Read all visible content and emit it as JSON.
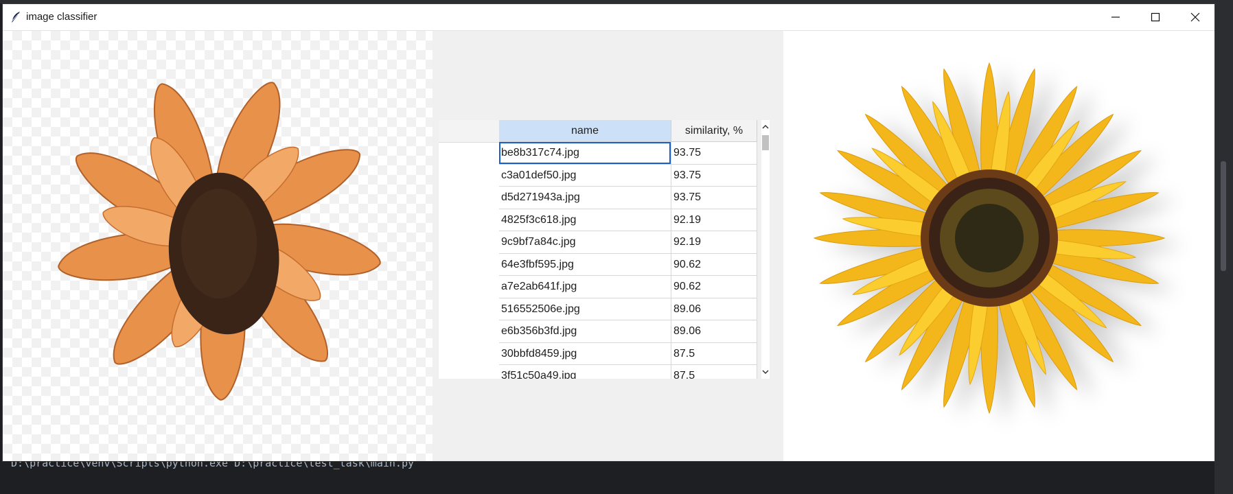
{
  "window": {
    "title": "image classifier"
  },
  "icons": {
    "app": "feather-icon",
    "minimize": "minimize-icon",
    "maximize": "maximize-icon",
    "close": "close-icon",
    "scroll_up": "chevron-up-icon",
    "scroll_down": "chevron-down-icon"
  },
  "images": {
    "query": "dried orange sunflower on transparent background",
    "match": "yellow sunflower on white background"
  },
  "table": {
    "columns": [
      "name",
      "similarity, %"
    ],
    "rows": [
      {
        "name": "be8b317c74.jpg",
        "similarity": "93.75"
      },
      {
        "name": "c3a01def50.jpg",
        "similarity": "93.75"
      },
      {
        "name": "d5d271943a.jpg",
        "similarity": "93.75"
      },
      {
        "name": "4825f3c618.jpg",
        "similarity": "92.19"
      },
      {
        "name": "9c9bf7a84c.jpg",
        "similarity": "92.19"
      },
      {
        "name": "64e3fbf595.jpg",
        "similarity": "90.62"
      },
      {
        "name": "a7e2ab641f.jpg",
        "similarity": "90.62"
      },
      {
        "name": "516552506e.jpg",
        "similarity": "89.06"
      },
      {
        "name": "e6b356b3fd.jpg",
        "similarity": "89.06"
      },
      {
        "name": "30bbfd8459.jpg",
        "similarity": "87.5"
      },
      {
        "name": "3f51c50a49.jpg",
        "similarity": "87.5"
      }
    ],
    "selected_row": 0
  },
  "terminal": {
    "command": "D:\\practice\\venv\\Scripts\\python.exe D:\\practice\\test_task\\main.py"
  },
  "colors": {
    "header_selected": "#cce0f7",
    "selection_border": "#1a5fc7",
    "petal_orange": "#e8914a",
    "petal_yellow": "#f6c21c",
    "center_dark": "#3a2418"
  }
}
